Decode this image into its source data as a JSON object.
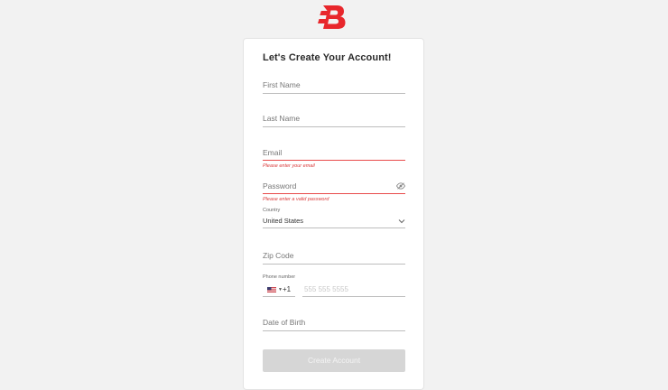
{
  "brand": {
    "logo_icon": "b-logo-icon",
    "accent": "#e8272c"
  },
  "form": {
    "title": "Let's Create Your Account!",
    "first_name": {
      "placeholder": "First Name"
    },
    "last_name": {
      "placeholder": "Last Name"
    },
    "email": {
      "placeholder": "Email",
      "error": "Please enter your email"
    },
    "password": {
      "placeholder": "Password",
      "error": "Please enter a valid password"
    },
    "country": {
      "label": "Country",
      "value": "United States"
    },
    "zip": {
      "placeholder": "Zip Code"
    },
    "phone": {
      "label": "Phone number",
      "country_code": "+1",
      "placeholder": "555 555 5555"
    },
    "dob": {
      "placeholder": "Date of Birth"
    },
    "submit_label": "Create Account"
  }
}
